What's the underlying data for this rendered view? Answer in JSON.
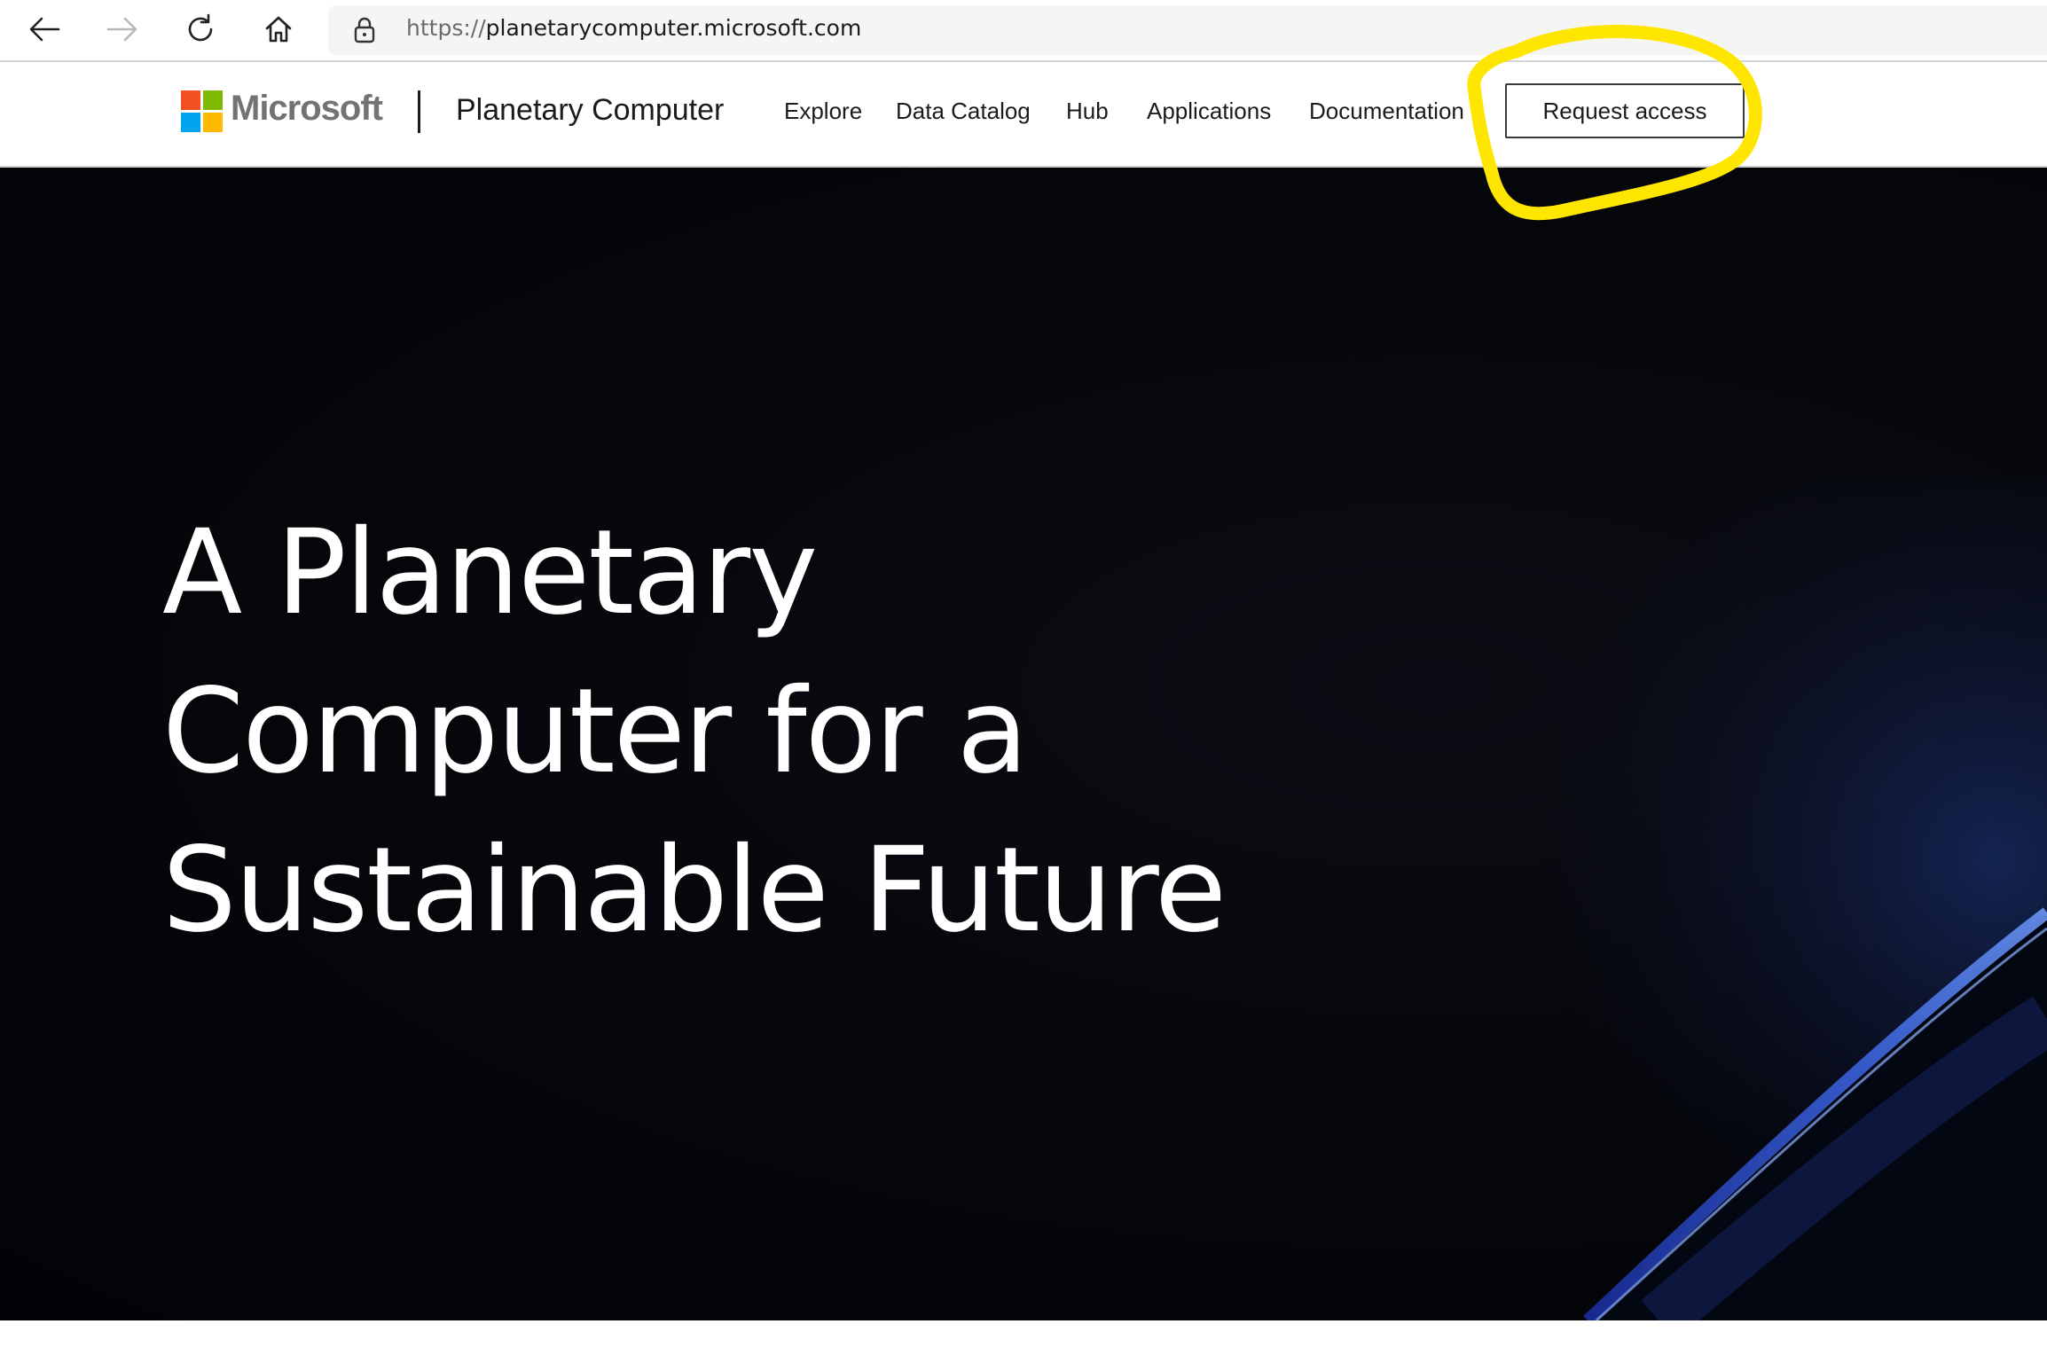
{
  "browser": {
    "url_scheme": "https://",
    "url_host": "planetarycomputer.microsoft.com",
    "icons": [
      "back-icon",
      "forward-icon",
      "refresh-icon",
      "home-icon",
      "lock-icon"
    ]
  },
  "header": {
    "brand": "Microsoft",
    "product": "Planetary Computer",
    "nav": [
      "Explore",
      "Data Catalog",
      "Hub",
      "Applications",
      "Documentation"
    ],
    "cta": "Request access"
  },
  "hero": {
    "heading_lines": [
      "A Planetary",
      "Computer for a",
      "Sustainable Future"
    ]
  },
  "colors": {
    "logo_red": "#f25022",
    "logo_green": "#7fba00",
    "logo_blue": "#00a4ef",
    "logo_yellow": "#ffb900",
    "annotation": "#ffe600",
    "hero_bg": "#03040a"
  }
}
